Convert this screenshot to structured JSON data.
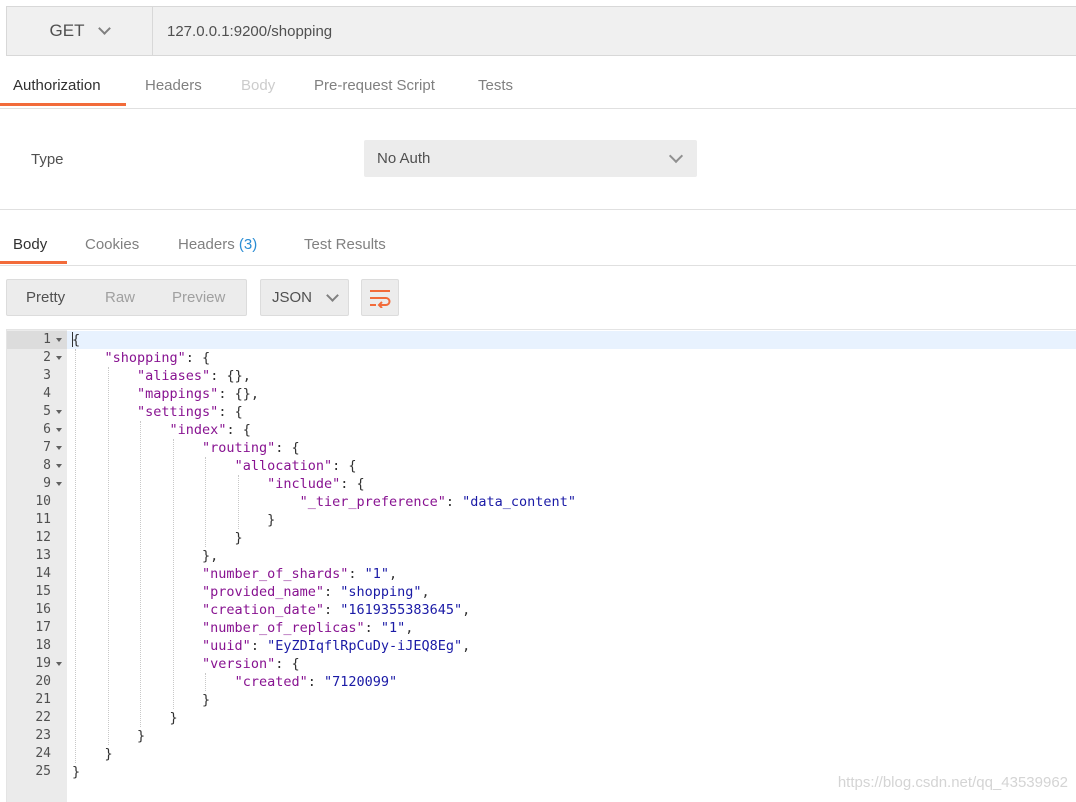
{
  "request": {
    "method": "GET",
    "url": "127.0.0.1:9200/shopping"
  },
  "request_tabs": [
    "Authorization",
    "Headers",
    "Body",
    "Pre-request Script",
    "Tests"
  ],
  "auth": {
    "type_label": "Type",
    "type_value": "No Auth"
  },
  "response_tabs": {
    "body": "Body",
    "cookies": "Cookies",
    "headers": "Headers",
    "headers_count": "(3)",
    "test_results": "Test Results"
  },
  "response_view": {
    "modes": [
      "Pretty",
      "Raw",
      "Preview"
    ],
    "format": "JSON",
    "wrap_icon": "wrap-lines-icon"
  },
  "accent_color": "#f26b3a",
  "code_lines": [
    {
      "n": "1",
      "fold": true,
      "text": "{"
    },
    {
      "n": "2",
      "fold": true,
      "text": "    \"shopping\": {"
    },
    {
      "n": "3",
      "fold": false,
      "text": "        \"aliases\": {},"
    },
    {
      "n": "4",
      "fold": false,
      "text": "        \"mappings\": {},"
    },
    {
      "n": "5",
      "fold": true,
      "text": "        \"settings\": {"
    },
    {
      "n": "6",
      "fold": true,
      "text": "            \"index\": {"
    },
    {
      "n": "7",
      "fold": true,
      "text": "                \"routing\": {"
    },
    {
      "n": "8",
      "fold": true,
      "text": "                    \"allocation\": {"
    },
    {
      "n": "9",
      "fold": true,
      "text": "                        \"include\": {"
    },
    {
      "n": "10",
      "fold": false,
      "text": "                            \"_tier_preference\": \"data_content\""
    },
    {
      "n": "11",
      "fold": false,
      "text": "                        }"
    },
    {
      "n": "12",
      "fold": false,
      "text": "                    }"
    },
    {
      "n": "13",
      "fold": false,
      "text": "                },"
    },
    {
      "n": "14",
      "fold": false,
      "text": "                \"number_of_shards\": \"1\","
    },
    {
      "n": "15",
      "fold": false,
      "text": "                \"provided_name\": \"shopping\","
    },
    {
      "n": "16",
      "fold": false,
      "text": "                \"creation_date\": \"1619355383645\","
    },
    {
      "n": "17",
      "fold": false,
      "text": "                \"number_of_replicas\": \"1\","
    },
    {
      "n": "18",
      "fold": false,
      "text": "                \"uuid\": \"EyZDIqflRpCuDy-iJEQ8Eg\","
    },
    {
      "n": "19",
      "fold": true,
      "text": "                \"version\": {"
    },
    {
      "n": "20",
      "fold": false,
      "text": "                    \"created\": \"7120099\""
    },
    {
      "n": "21",
      "fold": false,
      "text": "                }"
    },
    {
      "n": "22",
      "fold": false,
      "text": "            }"
    },
    {
      "n": "23",
      "fold": false,
      "text": "        }"
    },
    {
      "n": "24",
      "fold": false,
      "text": "    }"
    },
    {
      "n": "25",
      "fold": false,
      "text": "}"
    }
  ],
  "watermark": "https://blog.csdn.net/qq_43539962"
}
